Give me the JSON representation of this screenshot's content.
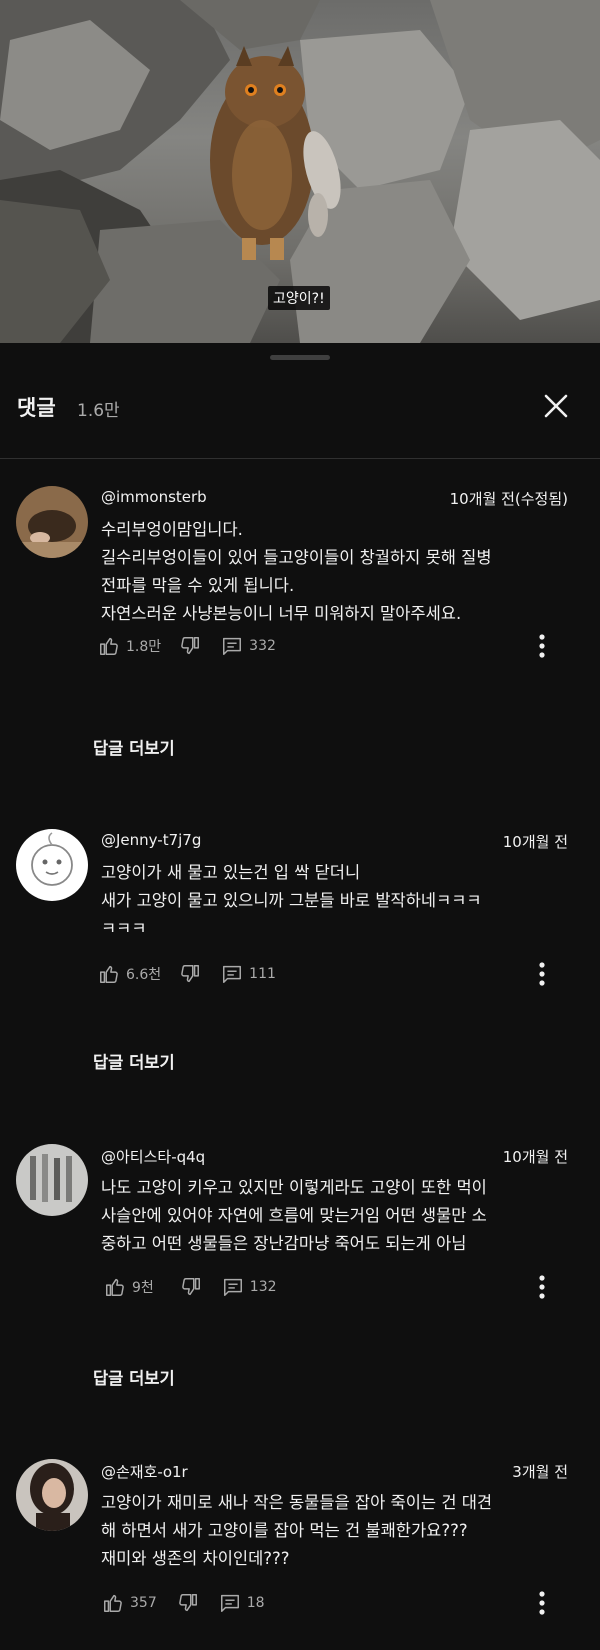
{
  "video": {
    "subtitle": "고양이?!"
  },
  "comments_panel": {
    "title": "댓글",
    "count": "1.6만",
    "close_icon": "close-icon",
    "comments": [
      {
        "author": "@immonsterb",
        "time": "10개월 전(수정됨)",
        "text": "수리부엉이맘입니다.\n길수리부엉이들이 있어 들고양이들이 창궐하지 못해 질병\n전파를 막을 수 있게 됩니다.\n자연스러운 사냥본능이니 너무 미워하지 말아주세요.",
        "likes": "1.8만",
        "replies": "332",
        "replies_label": "답글 더보기"
      },
      {
        "author": "@Jenny-t7j7g",
        "time": "10개월 전",
        "text": "고양이가 새 물고 있는건 입 싹 닫더니\n새가 고양이 물고 있으니까 그분들 바로 발작하네ㅋㅋㅋ\nㅋㅋㅋ",
        "likes": "6.6천",
        "replies": "111",
        "replies_label": "답글 더보기"
      },
      {
        "author": "@아티스타-q4q",
        "time": "10개월 전",
        "text": "나도 고양이 키우고 있지만 이렇게라도 고양이 또한 먹이\n사슬안에 있어야 자연에 흐름에 맞는거임 어떤 생물만 소\n중하고 어떤 생물들은 장난감마냥 죽어도 되는게 아님",
        "likes": "9천",
        "replies": "132",
        "replies_label": "답글 더보기"
      },
      {
        "author": "@손재호-o1r",
        "time": "3개월 전",
        "text": "고양이가 재미로 새나 작은 동물들을 잡아 죽이는 건 대견\n해 하면서 새가 고양이를 잡아 먹는 건 불쾌한가요???\n재미와 생존의 차이인데???",
        "likes": "357",
        "replies": "18"
      }
    ]
  }
}
